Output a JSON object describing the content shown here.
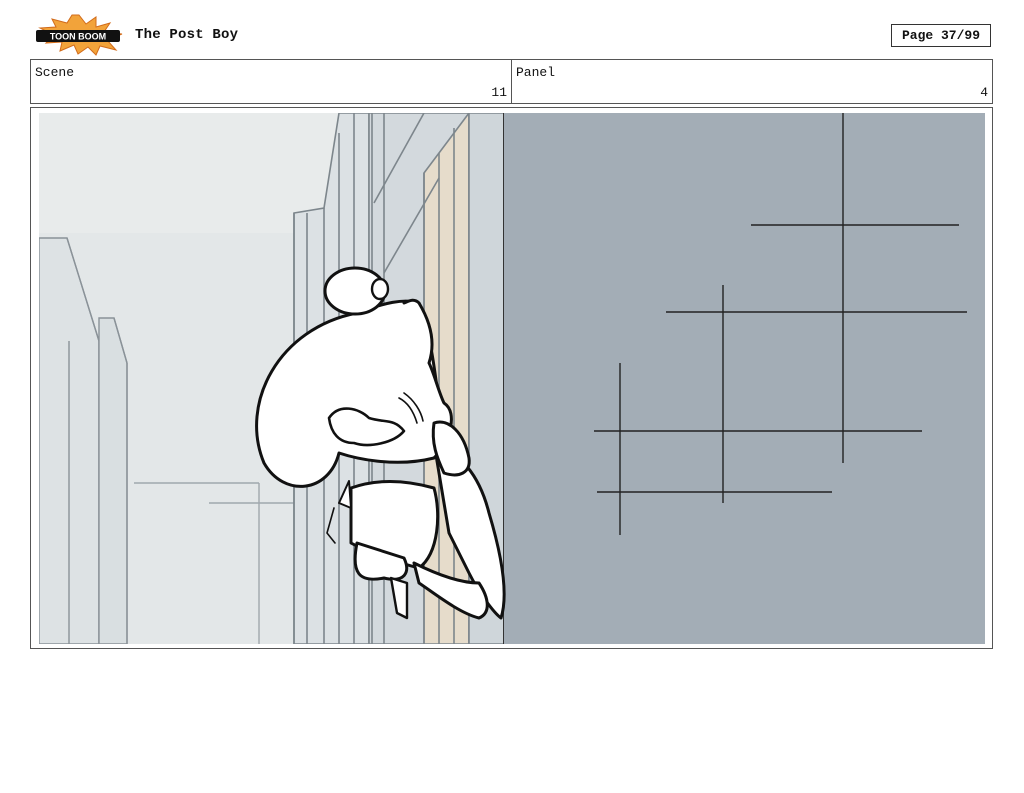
{
  "header": {
    "logo_text": "TOON BOOM",
    "title": "The Post Boy",
    "page": "Page 37/99"
  },
  "info": {
    "scene_label": "Scene",
    "scene_value": "11",
    "panel_label": "Panel",
    "panel_value": "4"
  },
  "artwork": {
    "description_icon": "storyboard-sketch",
    "colors": {
      "sky": "#e9ecec",
      "wall_right": "#a3adb6",
      "tan": "#e7dccb",
      "line": "#111111"
    }
  }
}
